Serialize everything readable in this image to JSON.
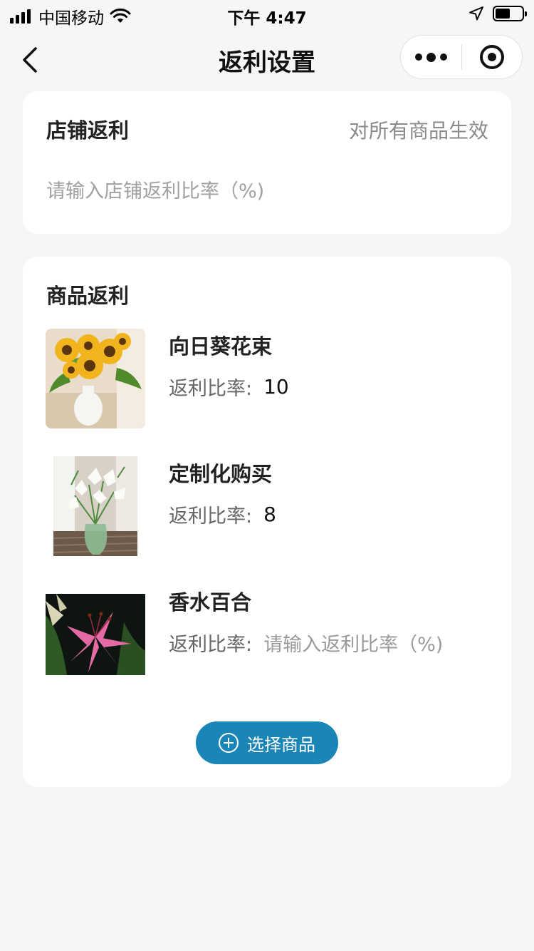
{
  "status_bar": {
    "carrier": "中国移动",
    "time": "下午 4:47",
    "battery_level": 0.55
  },
  "nav": {
    "title": "返利设置"
  },
  "shop_rebate": {
    "title": "店铺返利",
    "note": "对所有商品生效",
    "placeholder": "请输入店铺返利比率（%)"
  },
  "goods_rebate": {
    "title": "商品返利",
    "rate_label": "返利比率:",
    "items": [
      {
        "name": "向日葵花束",
        "rate": "10",
        "image": "sunflower-bouquet"
      },
      {
        "name": "定制化购买",
        "rate": "8",
        "image": "white-lily-vase"
      },
      {
        "name": "香水百合",
        "rate": "请输入返利比率（%)",
        "image": "pink-lily"
      }
    ],
    "select_button": "选择商品"
  },
  "colors": {
    "primary": "#1a86b7",
    "background": "#f6f6f6",
    "placeholder": "#a0a0a0"
  }
}
